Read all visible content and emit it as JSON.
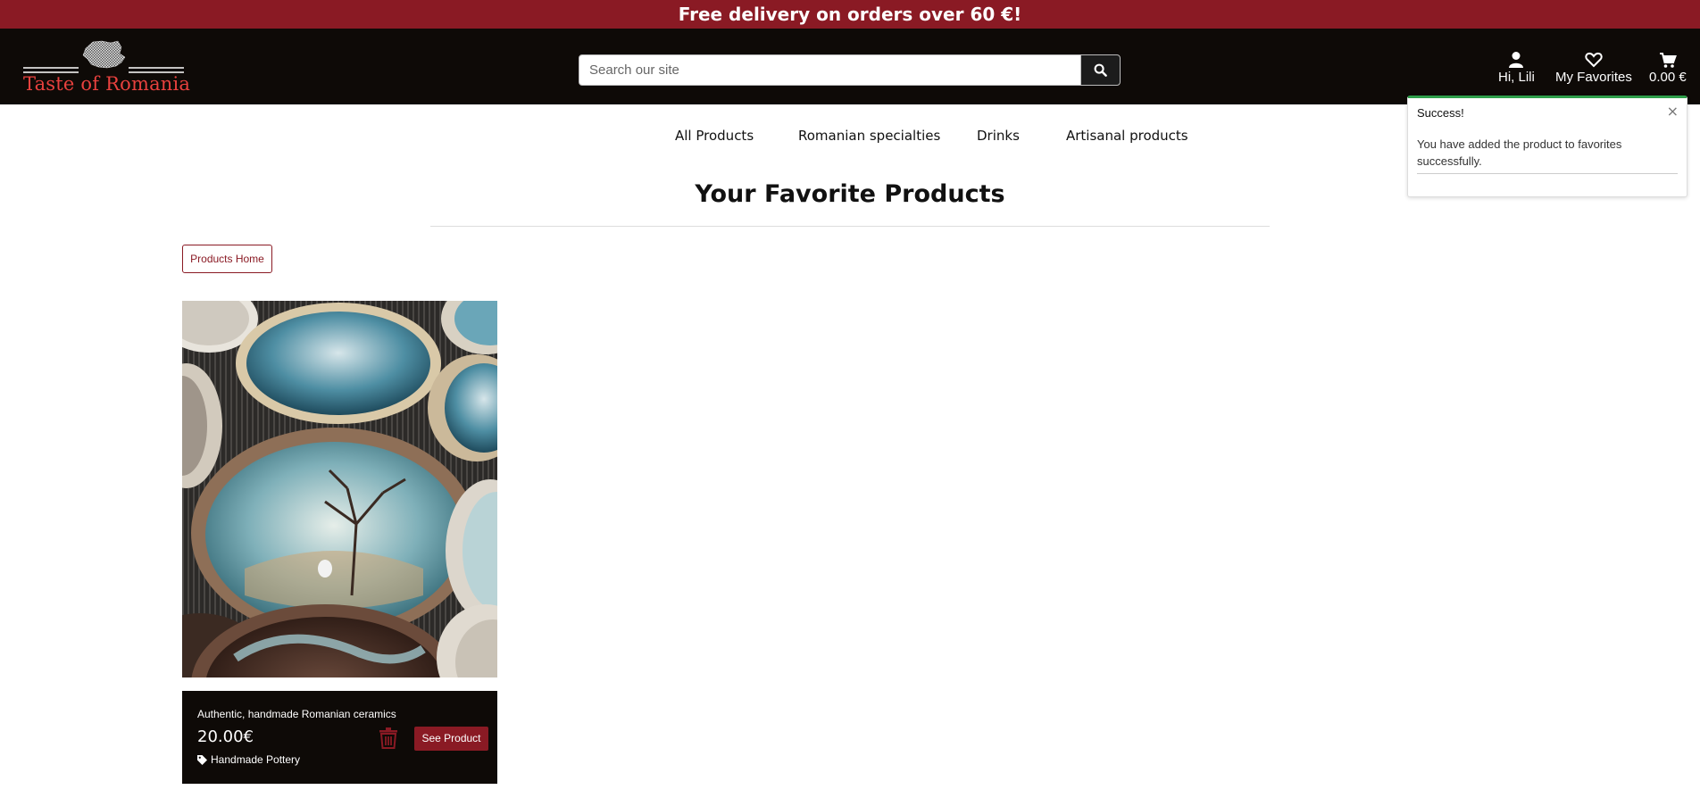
{
  "promo": {
    "text": "Free delivery on orders over 60 €!"
  },
  "header": {
    "logo_text": "Taste of Romania",
    "search": {
      "placeholder": "Search our site"
    },
    "account_label": "Hi, Lili",
    "favorites_label": "My Favorites",
    "cart_label": "0.00 €"
  },
  "nav": {
    "items": [
      {
        "label": "All Products"
      },
      {
        "label": "Romanian specialties"
      },
      {
        "label": "Drinks"
      },
      {
        "label": "Artisanal products"
      }
    ]
  },
  "main": {
    "title": "Your Favorite Products",
    "home_button": "Products Home",
    "products": [
      {
        "name": "Authentic, handmade Romanian ceramics",
        "price": "20.00€",
        "category": "Handmade Pottery",
        "see_button": "See Product"
      }
    ]
  },
  "toast": {
    "title": "Success!",
    "close_symbol": "×",
    "message": "You have added the product to favorites successfully."
  },
  "colors": {
    "brand": "#8a1a24",
    "header_bg": "#0e0a07",
    "logo_text": "#e8413e",
    "success": "#2e9e4a"
  },
  "icons": [
    "search-icon",
    "user-icon",
    "heart-icon",
    "cart-icon",
    "trash-icon",
    "tag-icon",
    "close-icon",
    "romania-map-icon"
  ]
}
